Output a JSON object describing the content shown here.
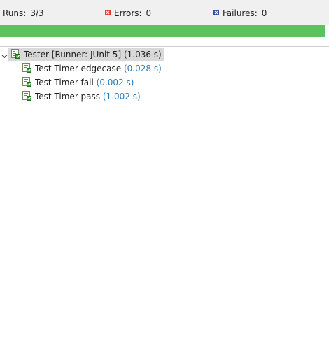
{
  "summary": {
    "runs_label": "Runs:",
    "runs_value": "3/3",
    "errors_label": "Errors:",
    "errors_value": "0",
    "failures_label": "Failures:",
    "failures_value": "0"
  },
  "progress": {
    "fraction": 1.0,
    "color": "#5dc15d"
  },
  "icons": {
    "errors": "error-icon",
    "failures": "failure-icon",
    "suite": "test-suite-icon",
    "test": "test-case-icon",
    "expand": "chevron-down-icon"
  },
  "tree": {
    "root": {
      "name": "Tester [Runner: JUnit 5]",
      "time": "(1.036 s)",
      "expanded": true
    },
    "children": [
      {
        "name": "Test Timer edgecase",
        "time": "(0.028 s)"
      },
      {
        "name": "Test Timer fail",
        "time": "(0.002 s)"
      },
      {
        "name": "Test Timer pass",
        "time": "(1.002 s)"
      }
    ]
  },
  "colors": {
    "success": "#5dc15d",
    "elapsed_text": "#2b7ab5",
    "error": "#d33d3d",
    "failure": "#2f4f8f"
  }
}
